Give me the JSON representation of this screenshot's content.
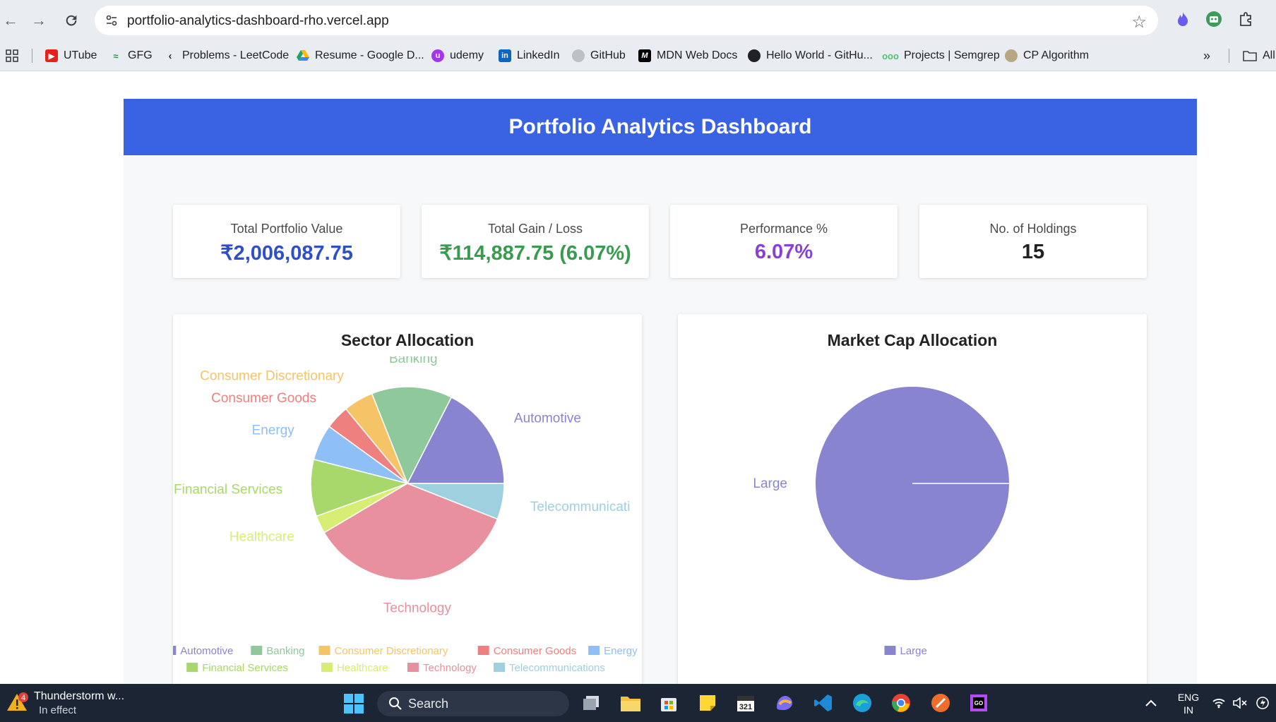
{
  "browser": {
    "url": "portfolio-analytics-dashboard-rho.vercel.app",
    "bookmarks": [
      {
        "label": "UTube",
        "icon": "youtube-icon",
        "color": "#e62117"
      },
      {
        "label": "GFG",
        "icon": "gfg-icon",
        "color": "#2f8d46"
      },
      {
        "label": "Problems - LeetCode",
        "icon": "leetcode-icon",
        "color": "#f0a02a"
      },
      {
        "label": "Resume - Google D...",
        "icon": "google-drive-icon",
        "color": "#1fa463"
      },
      {
        "label": "udemy",
        "icon": "udemy-icon",
        "color": "#a435f0"
      },
      {
        "label": "LinkedIn",
        "icon": "linkedin-icon",
        "color": "#0a66c2"
      },
      {
        "label": "GitHub",
        "icon": "github-icon",
        "color": "#9aa0a6"
      },
      {
        "label": "MDN Web Docs",
        "icon": "mdn-icon",
        "color": "#000000"
      },
      {
        "label": "Hello World - GitHu...",
        "icon": "github-icon",
        "color": "#202124"
      },
      {
        "label": "Projects | Semgrep",
        "icon": "semgrep-icon",
        "color": "#4fc36e"
      },
      {
        "label": "CP Algorithm",
        "icon": "cp-algorithm-icon",
        "color": "#8a7a5a"
      }
    ],
    "all_bookmarks_label": "All"
  },
  "dashboard": {
    "title": "Portfolio Analytics Dashboard",
    "stats": [
      {
        "label": "Total Portfolio Value",
        "value": "₹2,006,087.75",
        "color": "#2f4fc9"
      },
      {
        "label": "Total Gain / Loss",
        "value": "₹114,887.75 (6.07%)",
        "color": "#3a9a4f"
      },
      {
        "label": "Performance %",
        "value": "6.07%",
        "color": "#8a3fd6"
      },
      {
        "label": "No. of Holdings",
        "value": "15",
        "color": "#222222"
      }
    ]
  },
  "chart_data": [
    {
      "type": "pie",
      "title": "Sector Allocation",
      "start_angle_deg": 0,
      "direction": "counterclockwise",
      "outside_label_for": {
        "Telecommunications": "Telecommunicati"
      },
      "legend_position": "bottom",
      "series": [
        {
          "name": "Automotive",
          "value": 17.5,
          "color": "#8884d0"
        },
        {
          "name": "Banking",
          "value": 13.5,
          "color": "#8fc89a"
        },
        {
          "name": "Consumer Discretionary",
          "value": 5.0,
          "color": "#f5c466"
        },
        {
          "name": "Consumer Goods",
          "value": 4.0,
          "color": "#ef8080"
        },
        {
          "name": "Energy",
          "value": 6.0,
          "color": "#8ec0f7"
        },
        {
          "name": "Financial Services",
          "value": 9.5,
          "color": "#a8d86b"
        },
        {
          "name": "Healthcare",
          "value": 3.0,
          "color": "#d6ee73"
        },
        {
          "name": "Technology",
          "value": 35.5,
          "color": "#e8909e"
        },
        {
          "name": "Telecommunications",
          "value": 6.0,
          "color": "#9ed0e0"
        }
      ]
    },
    {
      "type": "pie",
      "title": "Market Cap Allocation",
      "legend_position": "bottom",
      "series": [
        {
          "name": "Large",
          "value": 100,
          "color": "#8884d0"
        }
      ]
    }
  ],
  "taskbar": {
    "weather_title": "Thunderstorm w...",
    "weather_sub": "In effect",
    "weather_badge": "4",
    "search_label": "Search",
    "language": "ENG",
    "region": "IN"
  }
}
